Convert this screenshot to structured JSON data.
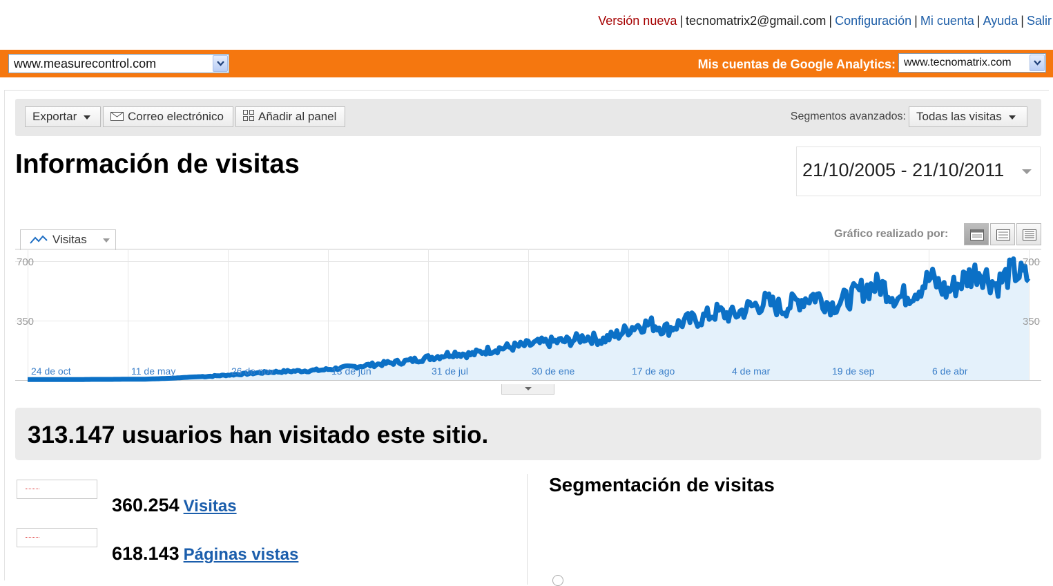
{
  "header": {
    "new_version": "Versión nueva",
    "email": "tecnomatrix2@gmail.com",
    "links": {
      "settings": "Configuración",
      "account": "Mi cuenta",
      "help": "Ayuda",
      "logout": "Salir"
    }
  },
  "orange_bar": {
    "site_select": "www.measurecontrol.com",
    "accounts_label": "Mis cuentas de Google Analytics:",
    "account_select": "www.tecnomatrix.com"
  },
  "toolbar": {
    "export_label": "Exportar",
    "email_label": "Correo electrónico",
    "dashboard_label": "Añadir al panel",
    "segments_label": "Segmentos avanzados:",
    "segments_value": "Todas las visitas"
  },
  "page": {
    "title": "Información de visitas",
    "date_range": "21/10/2005 - 21/10/2011"
  },
  "chart_controls": {
    "metric_tab": "Visitas",
    "graph_by_label": "Gráfico realizado por:"
  },
  "chart_data": {
    "type": "area",
    "y_ticks": [
      "700",
      "350"
    ],
    "ylim": [
      0,
      700
    ],
    "x_labels": [
      "24 de oct",
      "11 de may",
      "26 de nov",
      "13 de jun",
      "31 de jul",
      "30 de ene",
      "17 de ago",
      "4 de mar",
      "19 de sep",
      "6 de abr"
    ],
    "series": [
      {
        "values": [
          3,
          3,
          3,
          3,
          4,
          4,
          5,
          5,
          8,
          12,
          18,
          22,
          28,
          35,
          42,
          48,
          52,
          55,
          60,
          70,
          80,
          90,
          100,
          110,
          125,
          140,
          160,
          150,
          175,
          190,
          200,
          215,
          225,
          230,
          255,
          235,
          270,
          320,
          330,
          300,
          345,
          360,
          400,
          380,
          430,
          460,
          420,
          470,
          500,
          440,
          480,
          540,
          560,
          480,
          520,
          600,
          520,
          590,
          650,
          560,
          640,
          600
        ]
      }
    ],
    "color": "#0b70c6",
    "fill": "#e4f1fb"
  },
  "summary": {
    "text": "313.147 usuarios han visitado este sitio."
  },
  "metrics": [
    {
      "value": "360.254",
      "label": "Visitas"
    },
    {
      "value": "618.143",
      "label": "Páginas vistas"
    }
  ],
  "segmentation": {
    "title": "Segmentación de visitas"
  }
}
